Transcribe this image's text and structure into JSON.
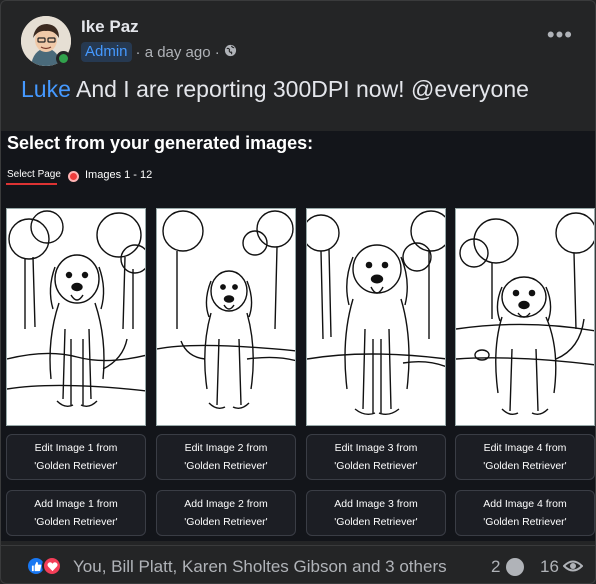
{
  "post": {
    "author": "Ike Paz",
    "role_badge": "Admin",
    "time": "· a day ago ·",
    "message_mention": "Luke",
    "message_text": " And I are reporting 300DPI now! @everyone",
    "more": "•••"
  },
  "panel": {
    "title": "Select from your generated images:",
    "tab_label": "Select Page",
    "range_label": "Images 1 - 12",
    "images": [
      {
        "edit_line1": "Edit Image 1 from",
        "edit_line2": "'Golden Retriever'",
        "add_line1": "Add Image 1 from",
        "add_line2": "'Golden Retriever'"
      },
      {
        "edit_line1": "Edit Image 2 from",
        "edit_line2": "'Golden Retriever'",
        "add_line1": "Add Image 2 from",
        "add_line2": "'Golden Retriever'"
      },
      {
        "edit_line1": "Edit Image 3 from",
        "edit_line2": "'Golden Retriever'",
        "add_line1": "Add Image 3 from",
        "add_line2": "'Golden Retriever'"
      },
      {
        "edit_line1": "Edit Image 4 from",
        "edit_line2": "'Golden Retriever'",
        "add_line1": "Add Image 4 from",
        "add_line2": "'Golden Retriever'"
      }
    ]
  },
  "footer": {
    "reactors": "You, Bill Platt, Karen Sholtes Gibson and 3 others",
    "comments": "2",
    "views": "16"
  },
  "icons": {
    "like": "thumbs-up-icon",
    "love": "heart-icon",
    "comment": "comment-bubble-icon",
    "views": "eye-icon",
    "privacy": "globe-icon"
  },
  "colors": {
    "accent": "#4599ff",
    "like": "#1877f2",
    "love": "#f33e58",
    "online": "#31a24c"
  }
}
